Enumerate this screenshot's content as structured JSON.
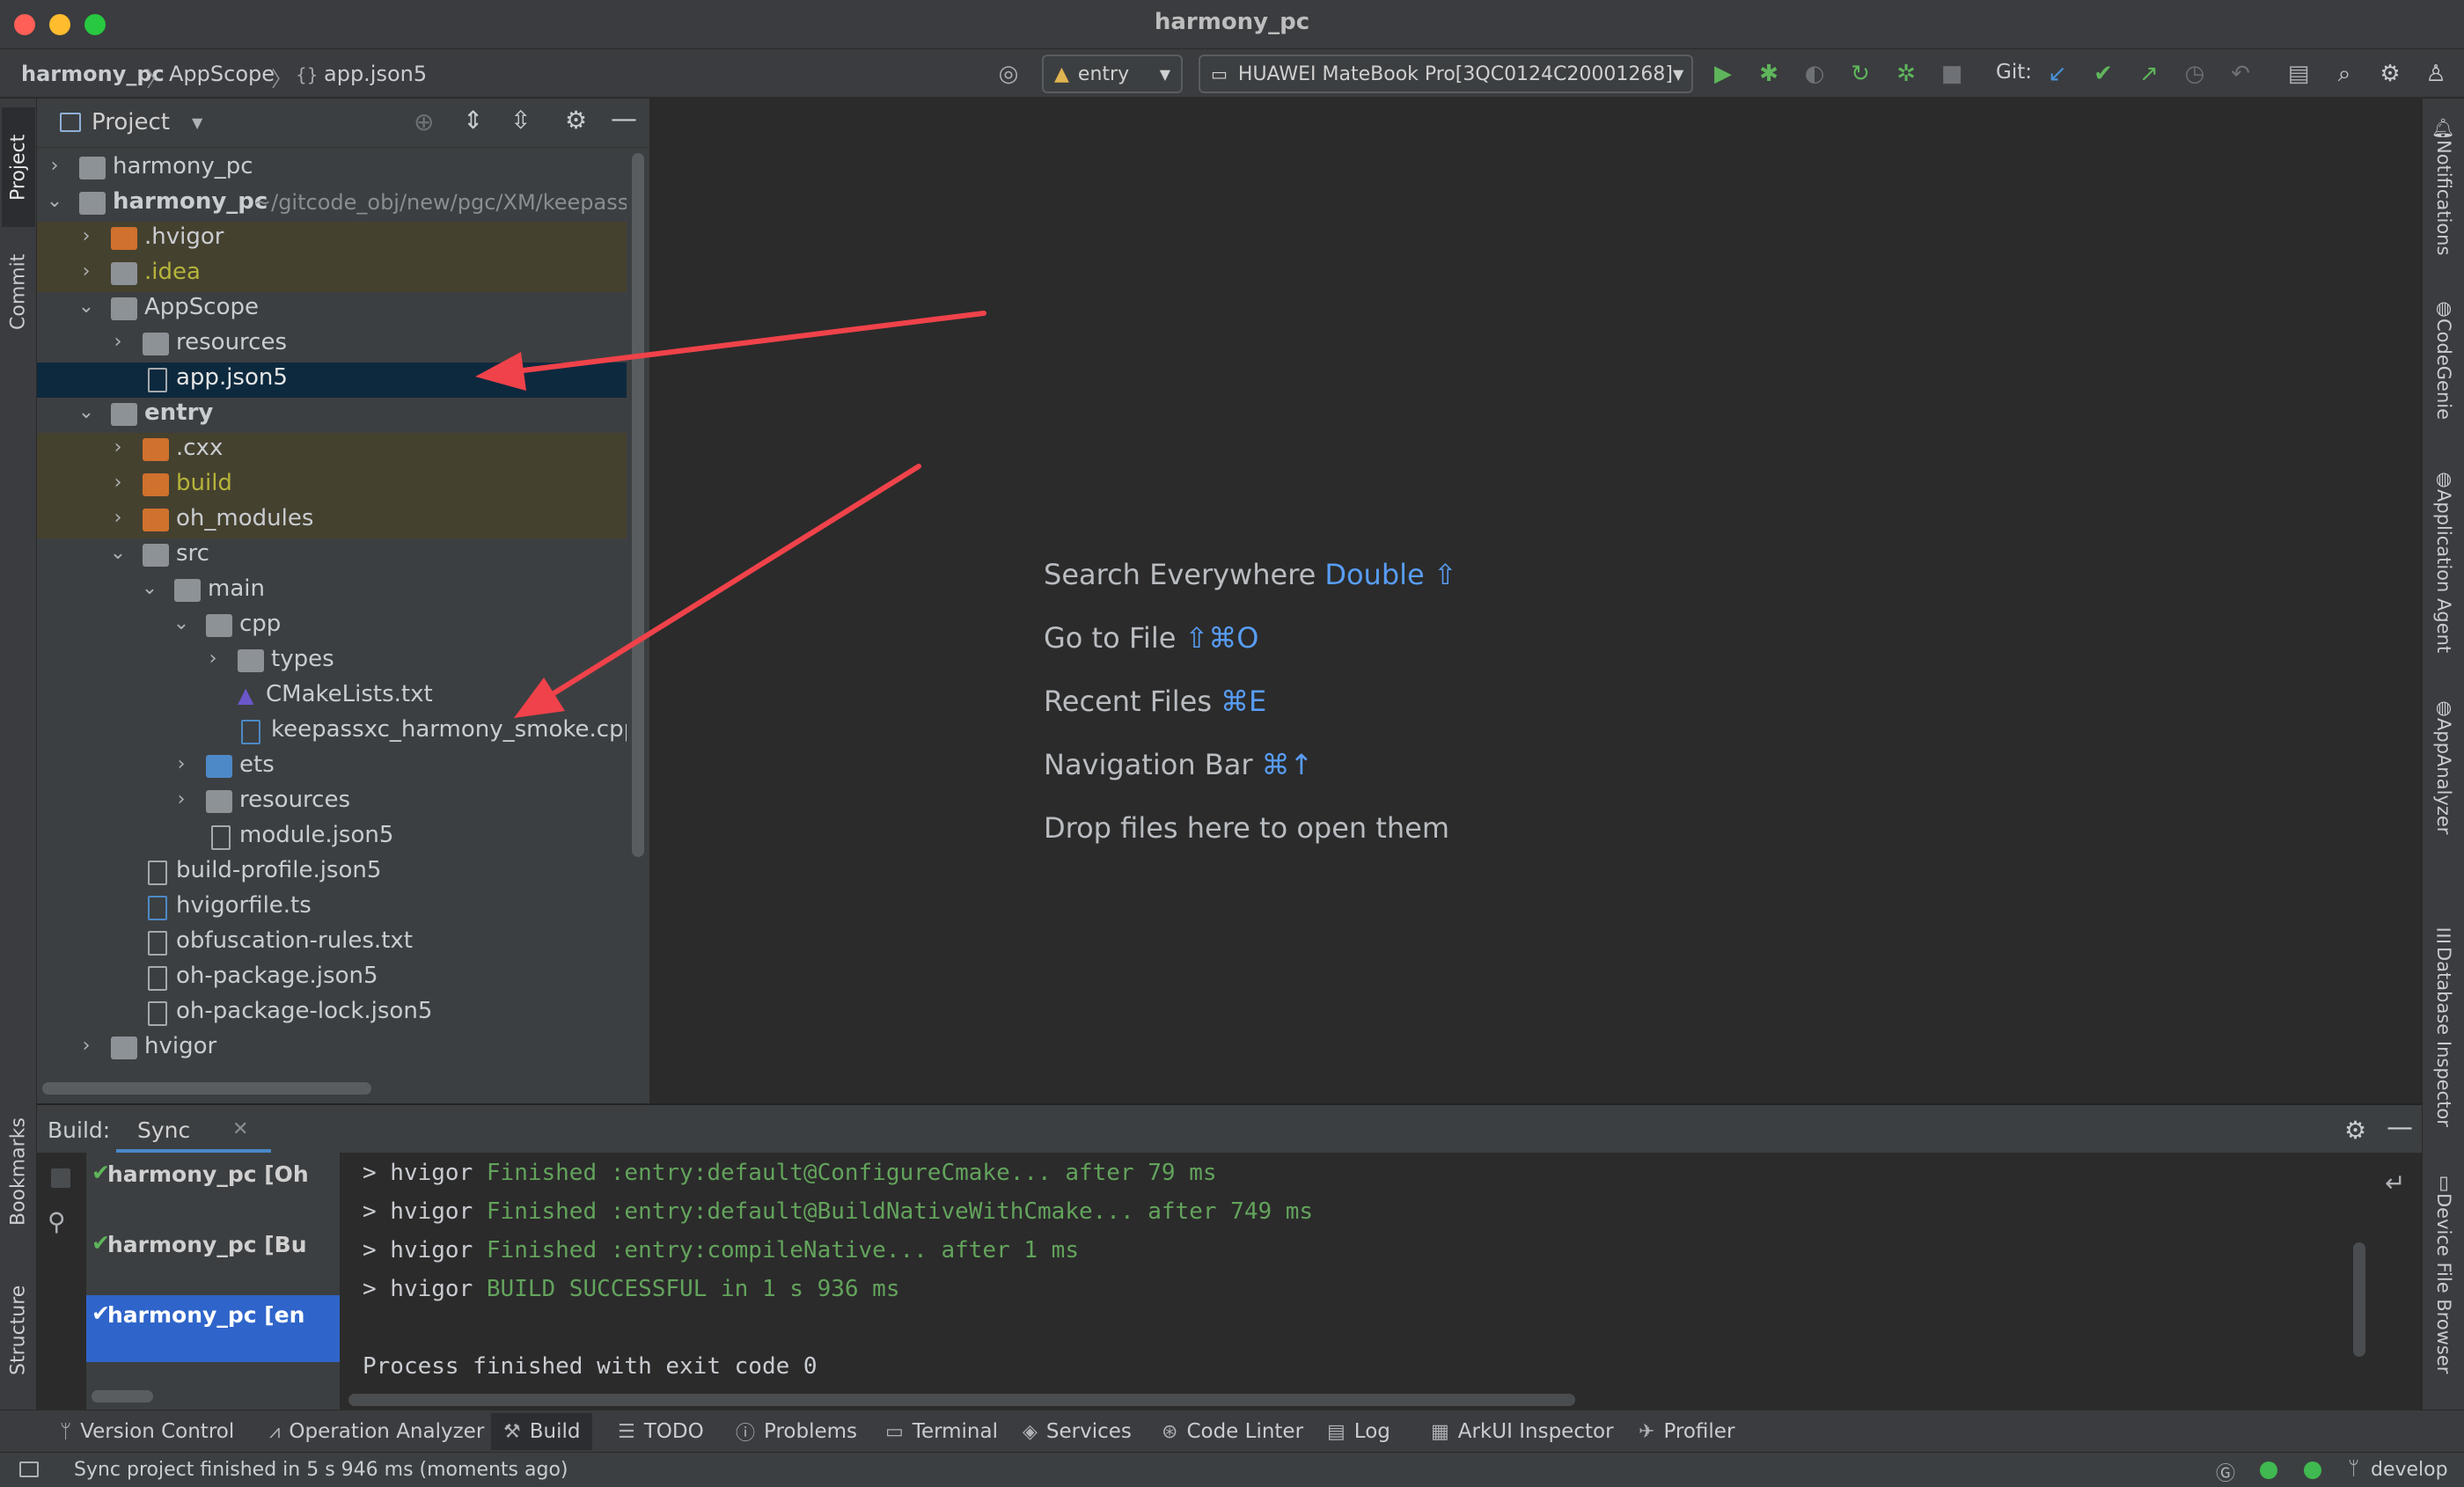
{
  "window": {
    "title": "harmony_pc"
  },
  "breadcrumb": [
    "harmony_pc",
    "AppScope",
    "app.json5"
  ],
  "toolbar": {
    "run_config": "entry",
    "device": "HUAWEI MateBook Pro[3QC0124C20001268]",
    "git_label": "Git:"
  },
  "left_tabs": {
    "project": "Project",
    "commit": "Commit",
    "bookmarks": "Bookmarks",
    "structure": "Structure"
  },
  "project_panel": {
    "title": "Project",
    "tree": [
      {
        "label": "harmony_pc",
        "path": ""
      },
      {
        "label": "harmony_pc",
        "path": "~/gitcode_obj/new/pgc/XM/keepass"
      },
      {
        "label": ".hvigor"
      },
      {
        "label": ".idea"
      },
      {
        "label": "AppScope"
      },
      {
        "label": "resources"
      },
      {
        "label": "app.json5"
      },
      {
        "label": "entry"
      },
      {
        "label": ".cxx"
      },
      {
        "label": "build"
      },
      {
        "label": "oh_modules"
      },
      {
        "label": "src"
      },
      {
        "label": "main"
      },
      {
        "label": "cpp"
      },
      {
        "label": "types"
      },
      {
        "label": "CMakeLists.txt"
      },
      {
        "label": "keepassxc_harmony_smoke.cpp"
      },
      {
        "label": "ets"
      },
      {
        "label": "resources"
      },
      {
        "label": "module.json5"
      },
      {
        "label": "build-profile.json5"
      },
      {
        "label": "hvigorfile.ts"
      },
      {
        "label": "obfuscation-rules.txt"
      },
      {
        "label": "oh-package.json5"
      },
      {
        "label": "oh-package-lock.json5"
      },
      {
        "label": "hvigor"
      }
    ]
  },
  "editor_hints": [
    {
      "label": "Search Everywhere",
      "key": "Double ⇧"
    },
    {
      "label": "Go to File",
      "key": "⇧⌘O"
    },
    {
      "label": "Recent Files",
      "key": "⌘E"
    },
    {
      "label": "Navigation Bar",
      "key": "⌘↑"
    },
    {
      "label": "Drop files here to open them",
      "key": ""
    }
  ],
  "right_tabs": {
    "notifications": "Notifications",
    "codegenie": "CodeGenie",
    "application_agent": "Application Agent",
    "appanalyzer": "AppAnalyzer",
    "database_inspector": "Database Inspector",
    "device_file_browser": "Device File Browser"
  },
  "build": {
    "label": "Build:",
    "tab": "Sync",
    "items": [
      "harmony_pc [Oh",
      "harmony_pc [Bu",
      "harmony_pc [en"
    ],
    "console": [
      {
        "prefix": "> hvigor ",
        "text": "Finished :entry:default@ConfigureCmake... after 79 ms"
      },
      {
        "prefix": "> hvigor ",
        "text": "Finished :entry:default@BuildNativeWithCmake... after 749 ms"
      },
      {
        "prefix": "> hvigor ",
        "text": "Finished :entry:compileNative... after 1 ms"
      },
      {
        "prefix": "> hvigor ",
        "text": "BUILD SUCCESSFUL in 1 s 936 ms"
      }
    ],
    "exit_line": "Process finished with exit code 0"
  },
  "bottom_tools": [
    "Version Control",
    "Operation Analyzer",
    "Build",
    "TODO",
    "Problems",
    "Terminal",
    "Services",
    "Code Linter",
    "Log",
    "ArkUI Inspector",
    "Profiler"
  ],
  "status": {
    "message": "Sync project finished in 5 s 946 ms (moments ago)",
    "branch": "develop"
  },
  "colors": {
    "accent": "#589df6",
    "selection": "#0d293e",
    "success": "#63a35c",
    "arrow": "#f0424a"
  }
}
